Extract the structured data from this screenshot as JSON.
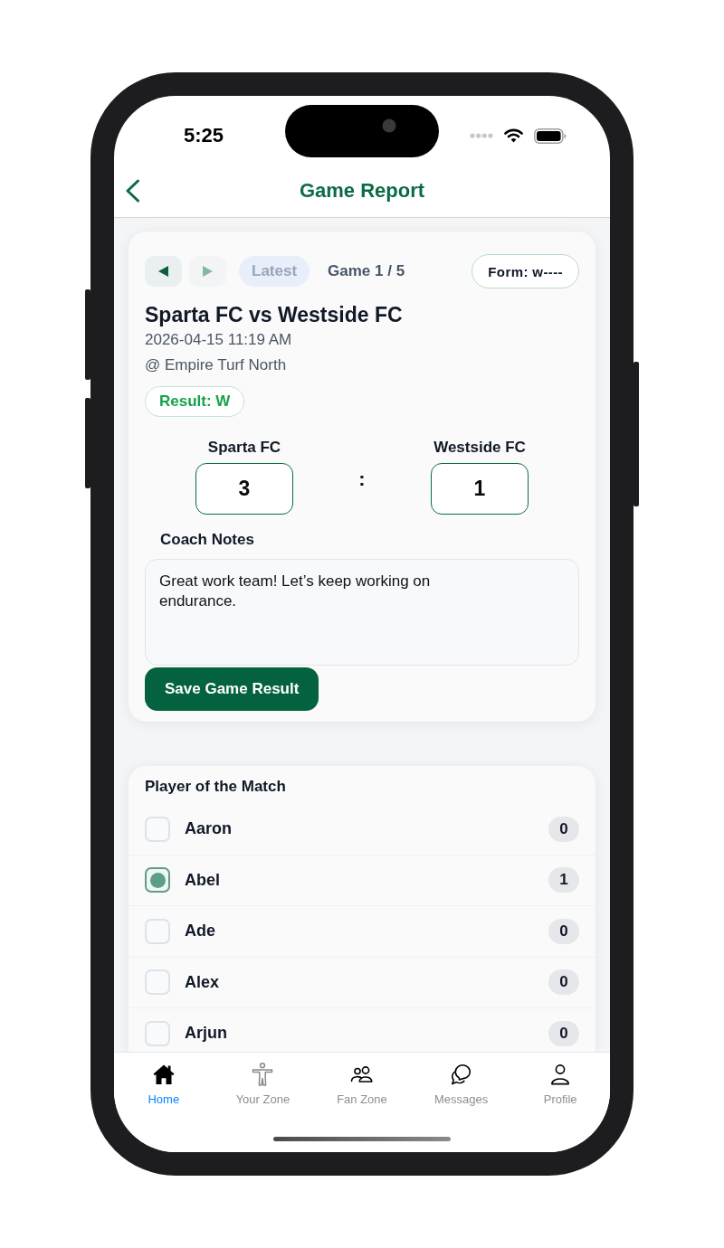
{
  "status_bar": {
    "time": "5:25"
  },
  "header": {
    "title": "Game Report"
  },
  "game_card": {
    "nav": {
      "prev": {
        "disabled": false
      },
      "next": {
        "disabled": true
      },
      "latest": {
        "label": "Latest",
        "disabled": true
      },
      "position": "Game 1 / 5"
    },
    "form": "Form: w----",
    "title": "Sparta FC vs Westside FC",
    "datetime": "2026-04-15 11:19 AM",
    "venue": "@ Empire Turf North",
    "result": {
      "label": "Result: W",
      "won": true
    },
    "score": {
      "home": {
        "team": "Sparta FC",
        "goals": "3"
      },
      "separator": ":",
      "away": {
        "team": "Westside FC",
        "goals": "1"
      }
    },
    "notes": {
      "label": "Coach Notes",
      "value": "Great work team! Let’s keep working on endurance."
    },
    "save_button": "Save Game Result"
  },
  "player_of_the_match": {
    "title": "Player of the Match",
    "players": [
      {
        "name": "Aaron",
        "votes": "0",
        "selected": false
      },
      {
        "name": "Abel",
        "votes": "1",
        "selected": true
      },
      {
        "name": "Ade",
        "votes": "0",
        "selected": false
      },
      {
        "name": "Alex",
        "votes": "0",
        "selected": false
      },
      {
        "name": "Arjun",
        "votes": "0",
        "selected": false
      }
    ]
  },
  "tab_bar": {
    "tabs": [
      {
        "label": "Home",
        "selected": true
      },
      {
        "label": "Your Zone",
        "selected": false
      },
      {
        "label": "Fan Zone",
        "selected": false
      },
      {
        "label": "Messages",
        "selected": false
      },
      {
        "label": "Profile",
        "selected": false
      }
    ]
  }
}
